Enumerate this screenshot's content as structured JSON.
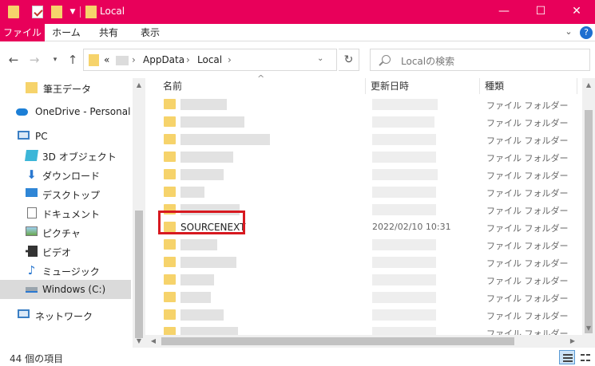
{
  "window": {
    "title": "Local",
    "controls": {
      "minimize": "—",
      "maximize": "☐",
      "close": "✕"
    }
  },
  "ribbon": {
    "tabs": [
      "ファイル",
      "ホーム",
      "共有",
      "表示"
    ],
    "help": "?"
  },
  "address": {
    "overflow": "«",
    "segments": [
      "AppData",
      "Local"
    ],
    "separator": "›",
    "search_placeholder": "Localの検索"
  },
  "nav": {
    "items": [
      {
        "label": "筆王データ",
        "icon": "folder-icon"
      },
      {
        "label": "OneDrive - Personal",
        "icon": "cloud-icon"
      },
      {
        "label": "PC",
        "icon": "pc-icon"
      },
      {
        "label": "3D オブジェクト",
        "icon": "cube-icon"
      },
      {
        "label": "ダウンロード",
        "icon": "download-icon"
      },
      {
        "label": "デスクトップ",
        "icon": "desktop-icon"
      },
      {
        "label": "ドキュメント",
        "icon": "document-icon"
      },
      {
        "label": "ピクチャ",
        "icon": "picture-icon"
      },
      {
        "label": "ビデオ",
        "icon": "video-icon"
      },
      {
        "label": "ミュージック",
        "icon": "music-icon"
      },
      {
        "label": "Windows (C:)",
        "icon": "drive-icon"
      },
      {
        "label": "ネットワーク",
        "icon": "network-icon"
      }
    ]
  },
  "columns": {
    "name": "名前",
    "date": "更新日時",
    "type": "種類"
  },
  "rows": [
    {
      "name": "",
      "date": "",
      "type": "ファイル フォルダー"
    },
    {
      "name": "",
      "date": "",
      "type": "ファイル フォルダー"
    },
    {
      "name": "",
      "date": "",
      "type": "ファイル フォルダー"
    },
    {
      "name": "",
      "date": "",
      "type": "ファイル フォルダー"
    },
    {
      "name": "",
      "date": "",
      "type": "ファイル フォルダー"
    },
    {
      "name": "",
      "date": "",
      "type": "ファイル フォルダー"
    },
    {
      "name": "",
      "date": "",
      "type": "ファイル フォルダー"
    },
    {
      "name": "SOURCENEXT",
      "date": "2022/02/10 10:31",
      "type": "ファイル フォルダー"
    },
    {
      "name": "",
      "date": "",
      "type": "ファイル フォルダー"
    },
    {
      "name": "",
      "date": "",
      "type": "ファイル フォルダー"
    },
    {
      "name": "",
      "date": "",
      "type": "ファイル フォルダー"
    },
    {
      "name": "",
      "date": "",
      "type": "ファイル フォルダー"
    },
    {
      "name": "",
      "date": "",
      "type": "ファイル フォルダー"
    },
    {
      "name": "",
      "date": "",
      "type": "ファイル フォルダー"
    }
  ],
  "status": {
    "item_count": "44 個の項目"
  },
  "colors": {
    "accent": "#e8005a",
    "folder": "#f6d36b",
    "highlight": "#d71920",
    "selection": "#dadada"
  }
}
